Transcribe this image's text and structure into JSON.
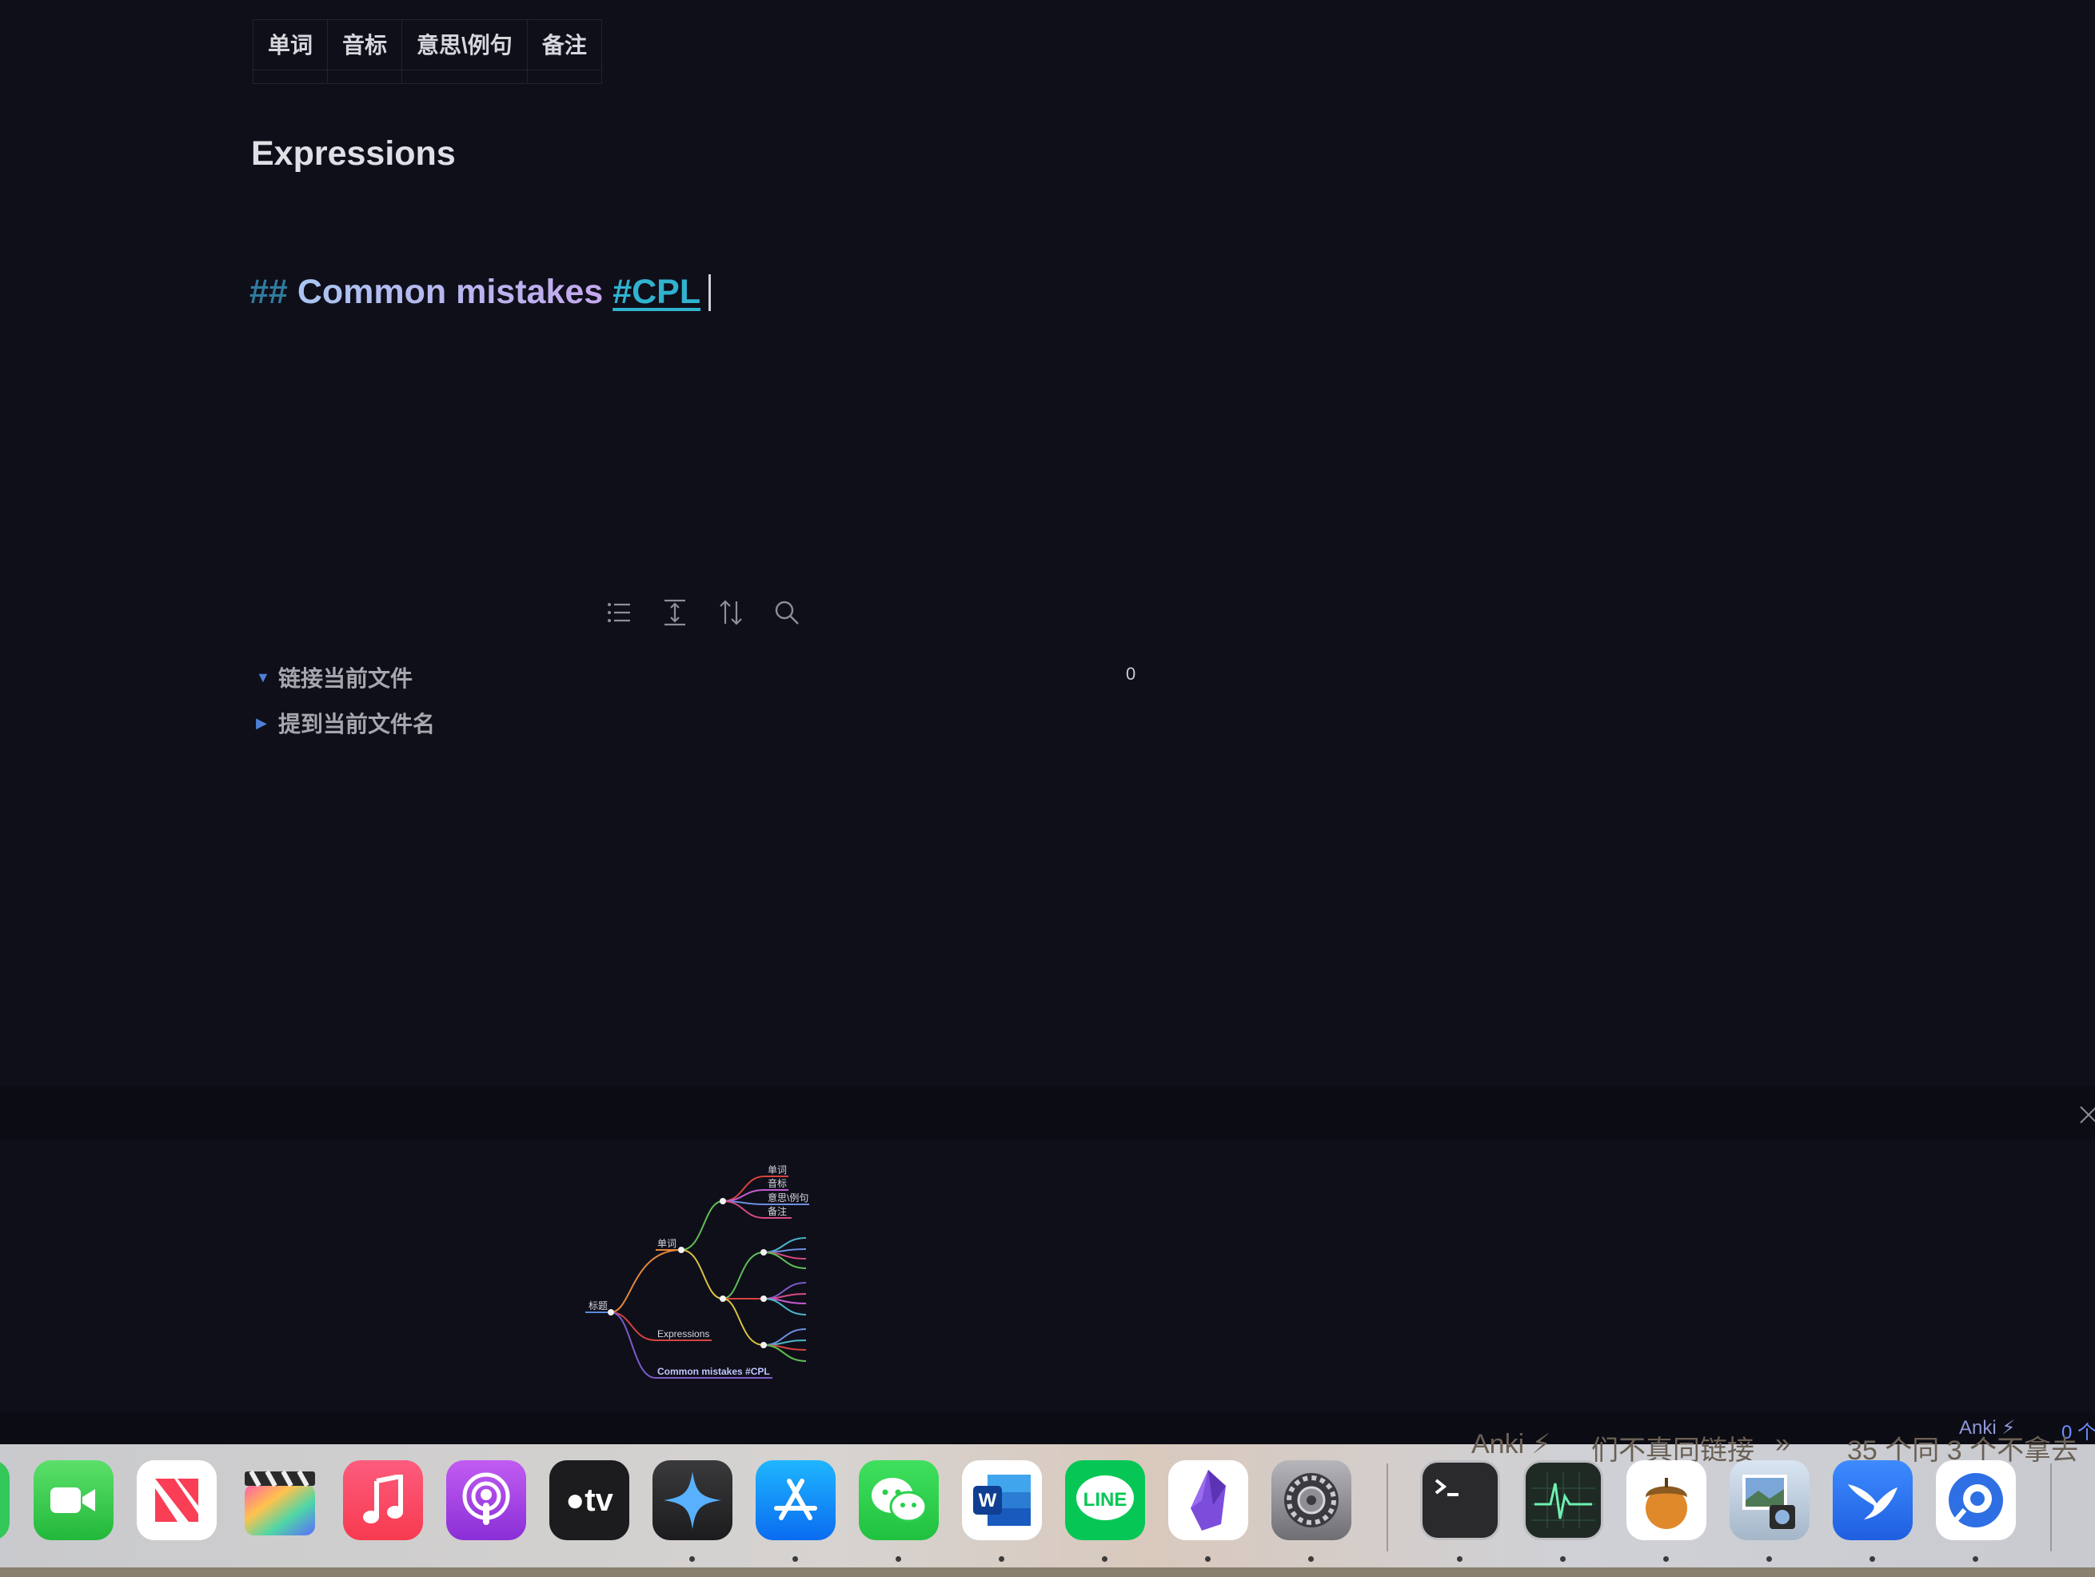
{
  "table": {
    "headers": [
      "单词",
      "音标",
      "意思\\例句",
      "备注"
    ]
  },
  "editor": {
    "heading_expressions": "Expressions",
    "heading_mistakes_prefix": "##",
    "heading_mistakes_text": "Common mistakes",
    "heading_mistakes_tag": "#CPL"
  },
  "backlinks": {
    "linked_label": "链接当前文件",
    "linked_count": "0",
    "unlinked_label": "提到当前文件名"
  },
  "mindmap": {
    "root": "标题",
    "nodes": [
      "单词",
      "Expressions",
      "Common mistakes #CPL"
    ],
    "leaves": [
      "单词",
      "音标",
      "意思\\例句",
      "备注"
    ]
  },
  "status": {
    "anki": "Anki ⚡",
    "count": "0 个"
  },
  "dock": {
    "background_texts": [
      "Anki ⚡",
      "们不真同链接",
      "»",
      "35 个同 3 个不拿去"
    ],
    "apps": [
      "Messages",
      "FaceTime",
      "News",
      "Final Cut Pro",
      "Music",
      "Podcasts",
      "Apple TV",
      "Spark",
      "App Store",
      "WeChat",
      "Microsoft Word",
      "LINE",
      "Obsidian",
      "System Settings",
      "Terminal",
      "Activity Monitor",
      "Anki",
      "Preview",
      "Lark",
      "Proxyman"
    ]
  },
  "colors": {
    "background": "#0f0f1a",
    "hash": "#2f7c9e",
    "tag": "#30b3cf",
    "accent_triangle": "#4e7fd6"
  }
}
